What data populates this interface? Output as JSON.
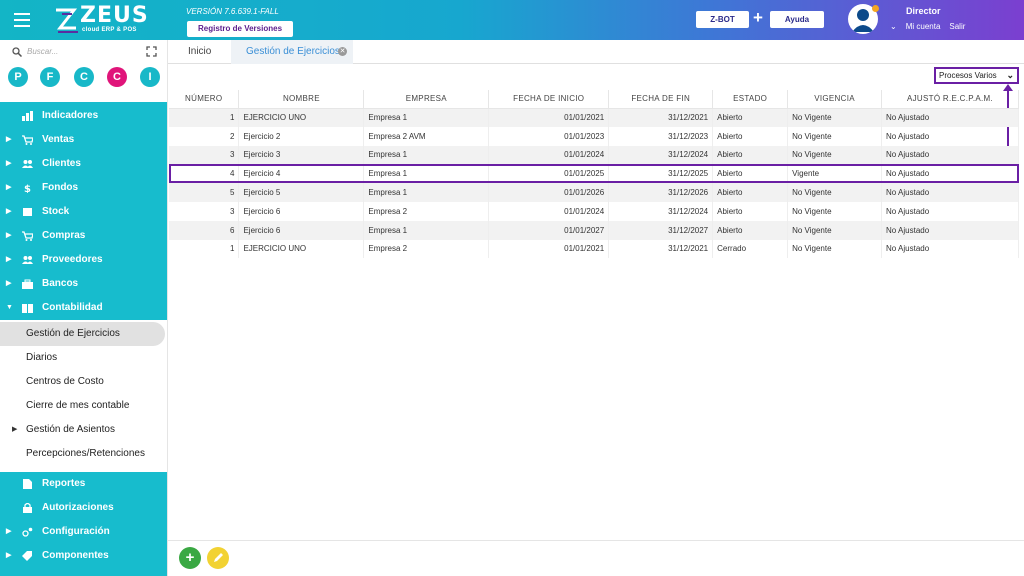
{
  "header": {
    "brand": "ZEUS",
    "brand_sub": "cloud ERP & POS",
    "version": "VERSIÓN 7.6.639.1-FALL",
    "versions_button": "Registro de Versiones",
    "zbot_button": "Z-BOT",
    "plus": "+",
    "help_button": "Ayuda",
    "user_name": "Director",
    "my_account": "Mi cuenta",
    "logout": "Salir"
  },
  "sidebar": {
    "search_placeholder": "Buscar...",
    "quick_buttons": [
      {
        "label": "P",
        "color": "#18b8c8"
      },
      {
        "label": "F",
        "color": "#18b8c8"
      },
      {
        "label": "C",
        "color": "#18b8c8"
      },
      {
        "label": "C",
        "color": "#e0157a"
      },
      {
        "label": "I",
        "color": "#18b8c8"
      }
    ],
    "items": [
      {
        "label": "Indicadores",
        "icon": "chart-icon"
      },
      {
        "label": "Ventas",
        "icon": "cart-icon"
      },
      {
        "label": "Clientes",
        "icon": "people-icon"
      },
      {
        "label": "Fondos",
        "icon": "dollar-icon"
      },
      {
        "label": "Stock",
        "icon": "box-icon"
      },
      {
        "label": "Compras",
        "icon": "cart-plus-icon"
      },
      {
        "label": "Proveedores",
        "icon": "people-icon"
      },
      {
        "label": "Bancos",
        "icon": "briefcase-icon"
      },
      {
        "label": "Contabilidad",
        "icon": "book-icon"
      }
    ],
    "sub_items": [
      {
        "label": "Gestión de Ejercicios"
      },
      {
        "label": "Diarios"
      },
      {
        "label": "Centros de Costo"
      },
      {
        "label": "Cierre de mes contable"
      },
      {
        "label": "Gestión de Asientos"
      },
      {
        "label": "Percepciones/Retenciones"
      }
    ],
    "bottom_items": [
      {
        "label": "Reportes",
        "icon": "document-icon"
      },
      {
        "label": "Autorizaciones",
        "icon": "lock-icon"
      },
      {
        "label": "Configuración",
        "icon": "gears-icon"
      },
      {
        "label": "Componentes",
        "icon": "tag-icon"
      }
    ]
  },
  "tabs": {
    "home": "Inicio",
    "active": "Gestión de Ejercicios"
  },
  "actions": {
    "procesos": "Procesos Varios"
  },
  "table": {
    "columns": [
      "NÚMERO",
      "NOMBRE",
      "EMPRESA",
      "FECHA DE INICIO",
      "FECHA DE FIN",
      "ESTADO",
      "VIGENCIA",
      "AJUSTÓ R.E.C.P.A.M."
    ],
    "rows": [
      [
        "1",
        "EJERCICIO UNO",
        "Empresa 1",
        "01/01/2021",
        "31/12/2021",
        "Abierto",
        "No Vigente",
        "No Ajustado"
      ],
      [
        "2",
        "Ejercicio 2",
        "Empresa 2 AVM",
        "01/01/2023",
        "31/12/2023",
        "Abierto",
        "No Vigente",
        "No Ajustado"
      ],
      [
        "3",
        "Ejercicio 3",
        "Empresa 1",
        "01/01/2024",
        "31/12/2024",
        "Abierto",
        "No Vigente",
        "No Ajustado"
      ],
      [
        "4",
        "Ejercicio 4",
        "Empresa 1",
        "01/01/2025",
        "31/12/2025",
        "Abierto",
        "Vigente",
        "No Ajustado"
      ],
      [
        "5",
        "Ejercicio 5",
        "Empresa 1",
        "01/01/2026",
        "31/12/2026",
        "Abierto",
        "No Vigente",
        "No Ajustado"
      ],
      [
        "3",
        "Ejercicio 6",
        "Empresa 2",
        "01/01/2024",
        "31/12/2024",
        "Abierto",
        "No Vigente",
        "No Ajustado"
      ],
      [
        "6",
        "Ejercicio 6",
        "Empresa 1",
        "01/01/2027",
        "31/12/2027",
        "Abierto",
        "No Vigente",
        "No Ajustado"
      ],
      [
        "1",
        "EJERCICIO UNO",
        "Empresa 2",
        "01/01/2021",
        "31/12/2021",
        "Cerrado",
        "No Vigente",
        "No Ajustado"
      ]
    ]
  },
  "fabs": {
    "add": "+",
    "edit_icon": "pencil-icon"
  },
  "colors": {
    "sidebar": "#17bccd",
    "accent_purple": "#6a1fa4",
    "ok_green": "#2a9a2a",
    "bad_red": "#e02020",
    "fab_add": "#3aa843",
    "fab_edit": "#f2d233"
  }
}
